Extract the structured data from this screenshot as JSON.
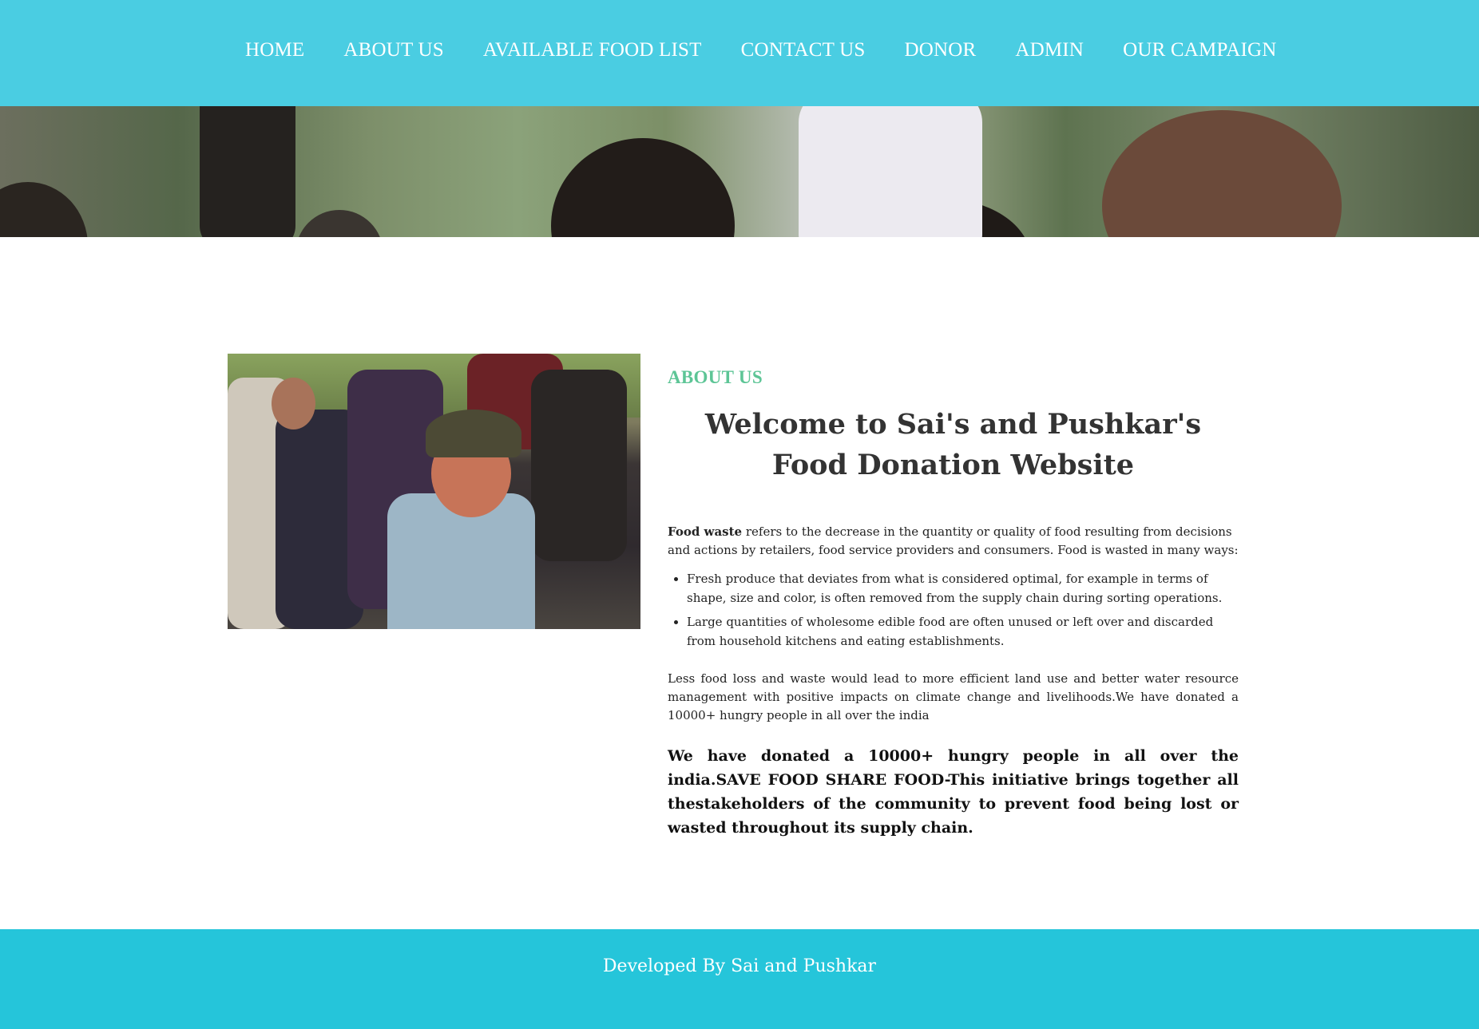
{
  "nav": {
    "items": [
      {
        "label": "HOME"
      },
      {
        "label": "ABOUT US"
      },
      {
        "label": "AVAILABLE FOOD LIST"
      },
      {
        "label": "CONTACT US"
      },
      {
        "label": "DONOR"
      },
      {
        "label": "ADMIN"
      },
      {
        "label": "OUR CAMPAIGN"
      }
    ]
  },
  "colors": {
    "nav_bg": "#4acde2",
    "accent_green": "#5dc596",
    "footer_bg": "#25c5da"
  },
  "about": {
    "label": "ABOUT US",
    "title": "Welcome to Sai's and Pushkar's Food Donation Website",
    "intro_bold": "Food waste",
    "intro_rest": " refers to the decrease in the quantity or quality of food resulting from decisions and actions by retailers, food service providers and consumers.  Food is wasted in many ways:",
    "bullets": [
      "Fresh produce that deviates from what is considered optimal, for example in terms of shape, size and color, is often removed from the supply chain during sorting operations.",
      "Large quantities of wholesome edible food are often unused or left over and discarded from household kitchens and eating establishments."
    ],
    "paragraph": "Less food loss and waste would lead to more efficient land use and better water resource management with positive impacts on climate change and livelihoods.We have donated a 10000+ hungry people in all over the india",
    "statement": "We have donated a 10000+ hungry people in all over the india.SAVE FOOD SHARE FOOD-This initiative brings together all thestakeholders of the community to prevent food being lost or wasted throughout its supply chain."
  },
  "footer": {
    "text": "Developed By Sai and Pushkar"
  }
}
